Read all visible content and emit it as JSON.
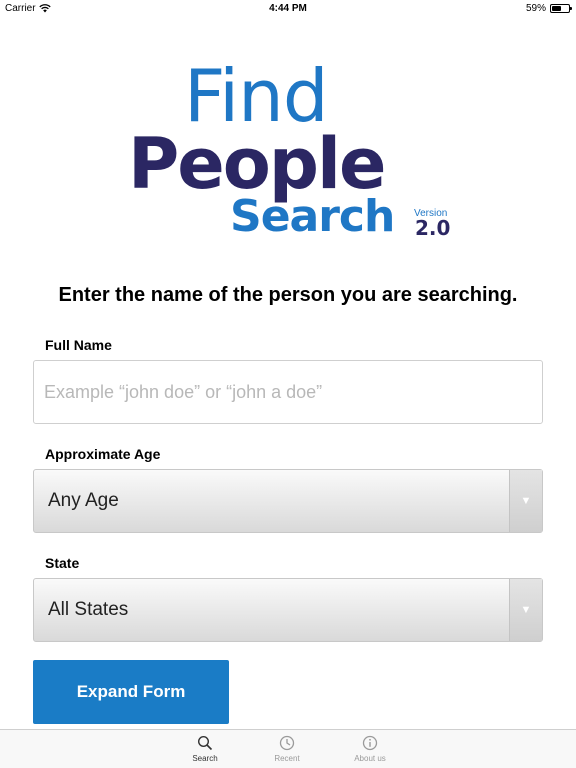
{
  "status_bar": {
    "carrier": "Carrier",
    "time": "4:44 PM",
    "battery_percent_label": "59%",
    "battery_level": 0.59
  },
  "logo": {
    "line1": "Find",
    "line2": "People",
    "line3": "Search",
    "version_label": "Version",
    "version_number": "2.0",
    "colors": {
      "blue": "#1f77c5",
      "navy": "#2b2763"
    }
  },
  "form": {
    "headline": "Enter the name of the person you are searching.",
    "full_name": {
      "label": "Full Name",
      "value": "",
      "placeholder": "Example “john doe” or “john a doe”"
    },
    "age": {
      "label": "Approximate Age",
      "selected": "Any Age"
    },
    "state": {
      "label": "State",
      "selected": "All States"
    },
    "expand_button_label": "Expand Form",
    "accent_color": "#1a7cc6"
  },
  "tab_bar": {
    "tabs": [
      {
        "label": "Search",
        "icon": "search-icon",
        "active": true
      },
      {
        "label": "Recent",
        "icon": "clock-icon",
        "active": false
      },
      {
        "label": "About us",
        "icon": "info-icon",
        "active": false
      }
    ]
  }
}
